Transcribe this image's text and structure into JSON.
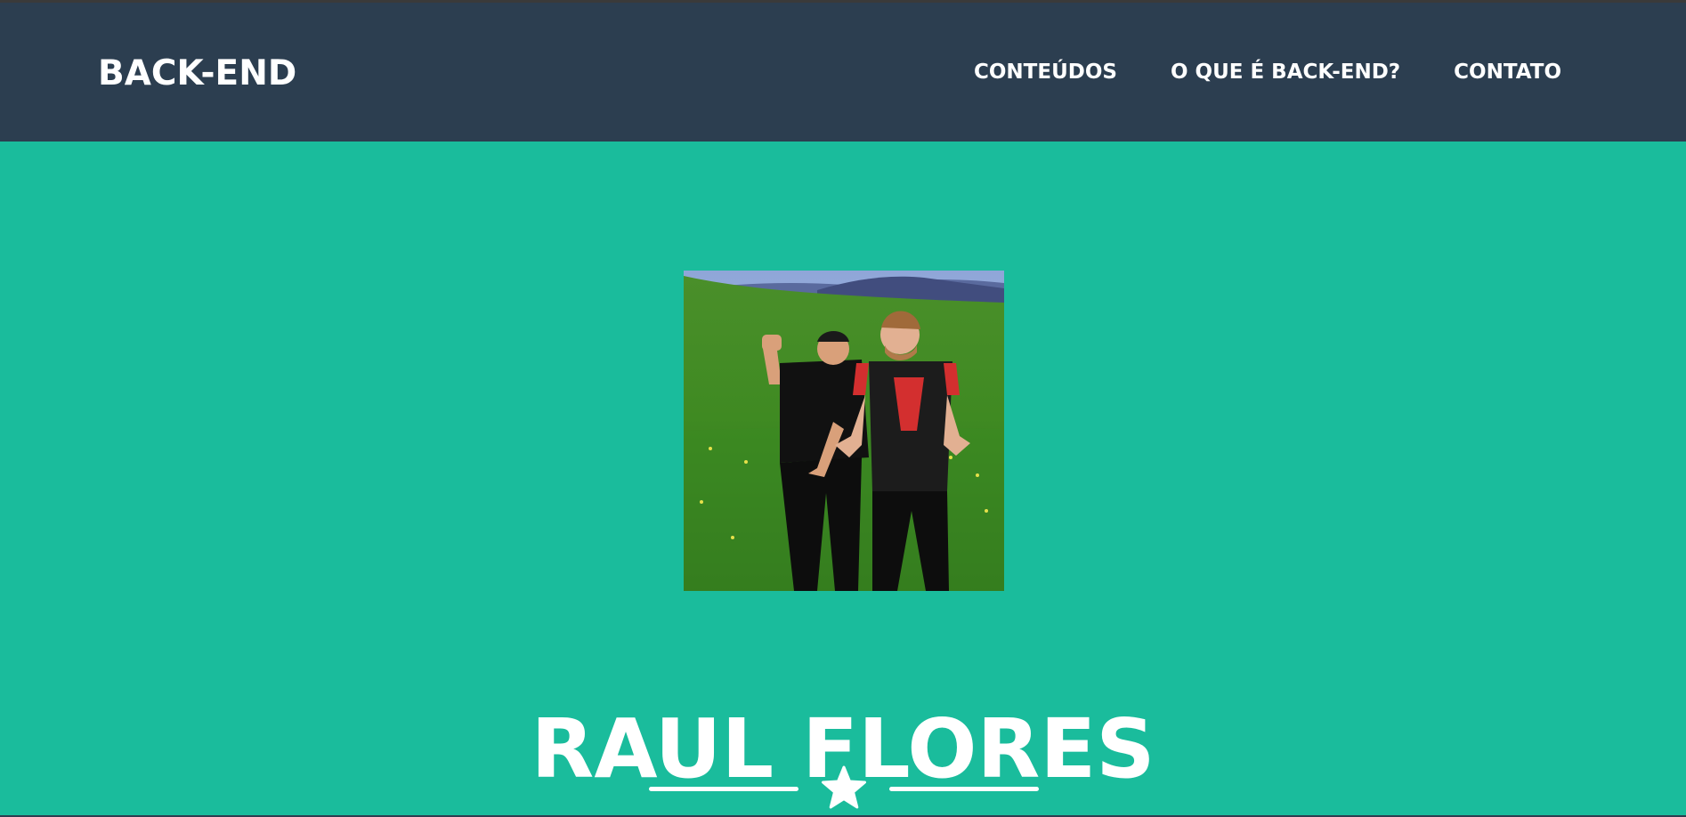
{
  "navbar": {
    "brand": "BACK-END",
    "links": [
      {
        "label": "CONTEÚDOS"
      },
      {
        "label": "O QUE É BACK-END?"
      },
      {
        "label": "CONTATO"
      }
    ]
  },
  "masthead": {
    "heading": "RAUL FLORES",
    "avatar_icon": "profile-photo",
    "divider_icon": "star-icon"
  },
  "colors": {
    "navbar_bg": "#2c3e50",
    "page_bg": "#1abc9c",
    "text": "#ffffff"
  }
}
